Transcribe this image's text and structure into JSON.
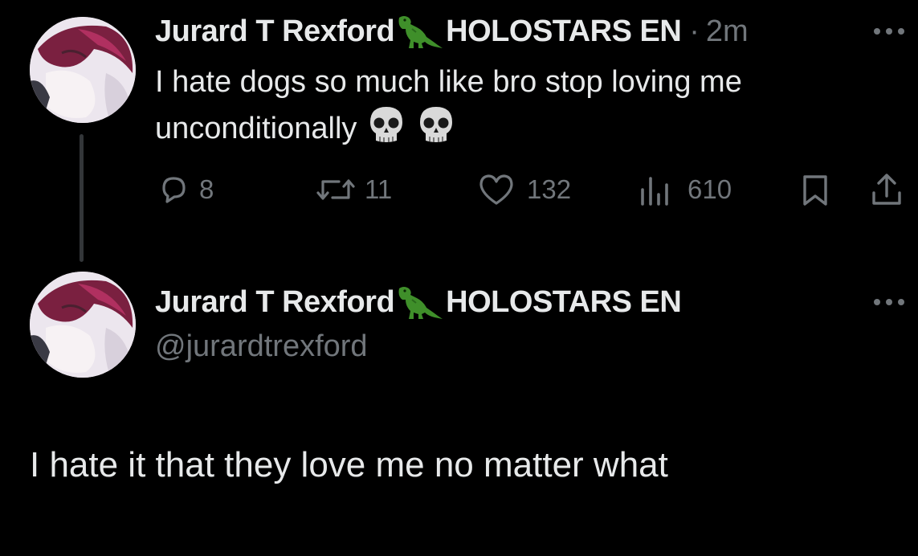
{
  "tweet": {
    "author_name": "Jurard T Rexford",
    "author_affiliation": "HOLOSTARS EN",
    "separator": "·",
    "time": "2m",
    "text": "I hate dogs so much like bro stop loving me unconditionally",
    "emojis": [
      "skull-emoji",
      "skull-emoji"
    ],
    "actions": {
      "replies": "8",
      "retweets": "11",
      "likes": "132",
      "views": "610"
    }
  },
  "reply": {
    "author_name": "Jurard T Rexford",
    "author_affiliation": "HOLOSTARS EN",
    "handle": "@jurardtrexford",
    "text": "I hate it that they love me no matter what"
  },
  "icons": {
    "name_emoji": "t-rex-emoji",
    "more": "more-dots-icon",
    "reply": "reply-bubble-icon",
    "retweet": "retweet-icon",
    "like": "heart-icon",
    "views": "views-bars-icon",
    "bookmark": "bookmark-icon",
    "share": "share-icon"
  },
  "colors": {
    "background": "#000000",
    "primary_text": "#e7e9ea",
    "secondary_text": "#71767b",
    "thread_line": "#333639"
  }
}
